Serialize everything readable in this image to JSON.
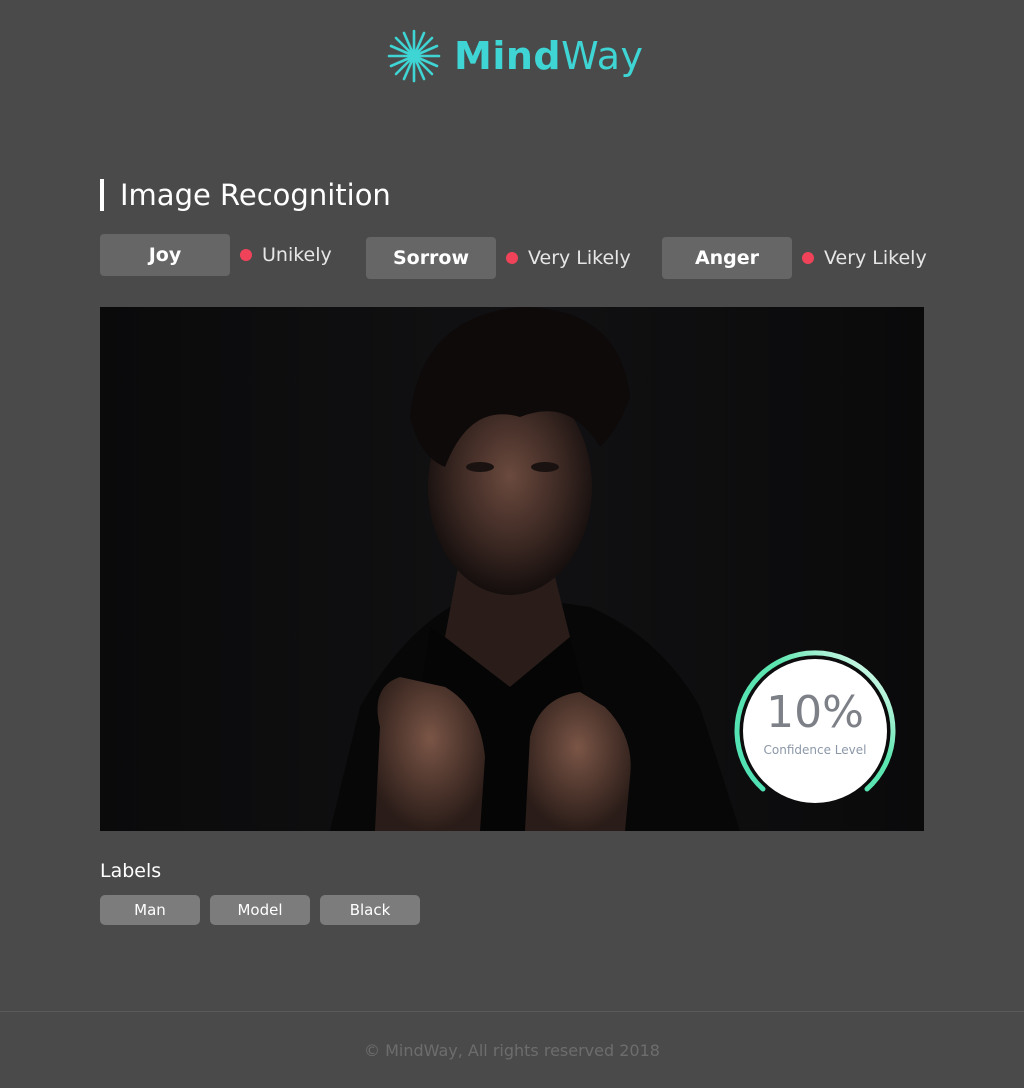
{
  "brand": {
    "name_bold": "Mind",
    "name_light": "Way",
    "accent_color": "#3ed5d4",
    "logo_icon": "starburst-logo-icon"
  },
  "section": {
    "title": "Image Recognition"
  },
  "emotions": [
    {
      "label": "Joy",
      "likelihood": "Unikely",
      "indicator_color": "#f0435a"
    },
    {
      "label": "Sorrow",
      "likelihood": "Very Likely",
      "indicator_color": "#f0435a"
    },
    {
      "label": "Anger",
      "likelihood": "Very Likely",
      "indicator_color": "#f0435a"
    }
  ],
  "image": {
    "subject": "portrait-photo"
  },
  "confidence": {
    "value_text": "10%",
    "label": "Confidence Level",
    "gradient_colors": [
      "#4fe0b4",
      "#ffffff"
    ]
  },
  "labels": {
    "title": "Labels",
    "items": [
      "Man",
      "Model",
      "Black"
    ]
  },
  "footer": {
    "text": "© MindWay, All rights reserved 2018"
  }
}
